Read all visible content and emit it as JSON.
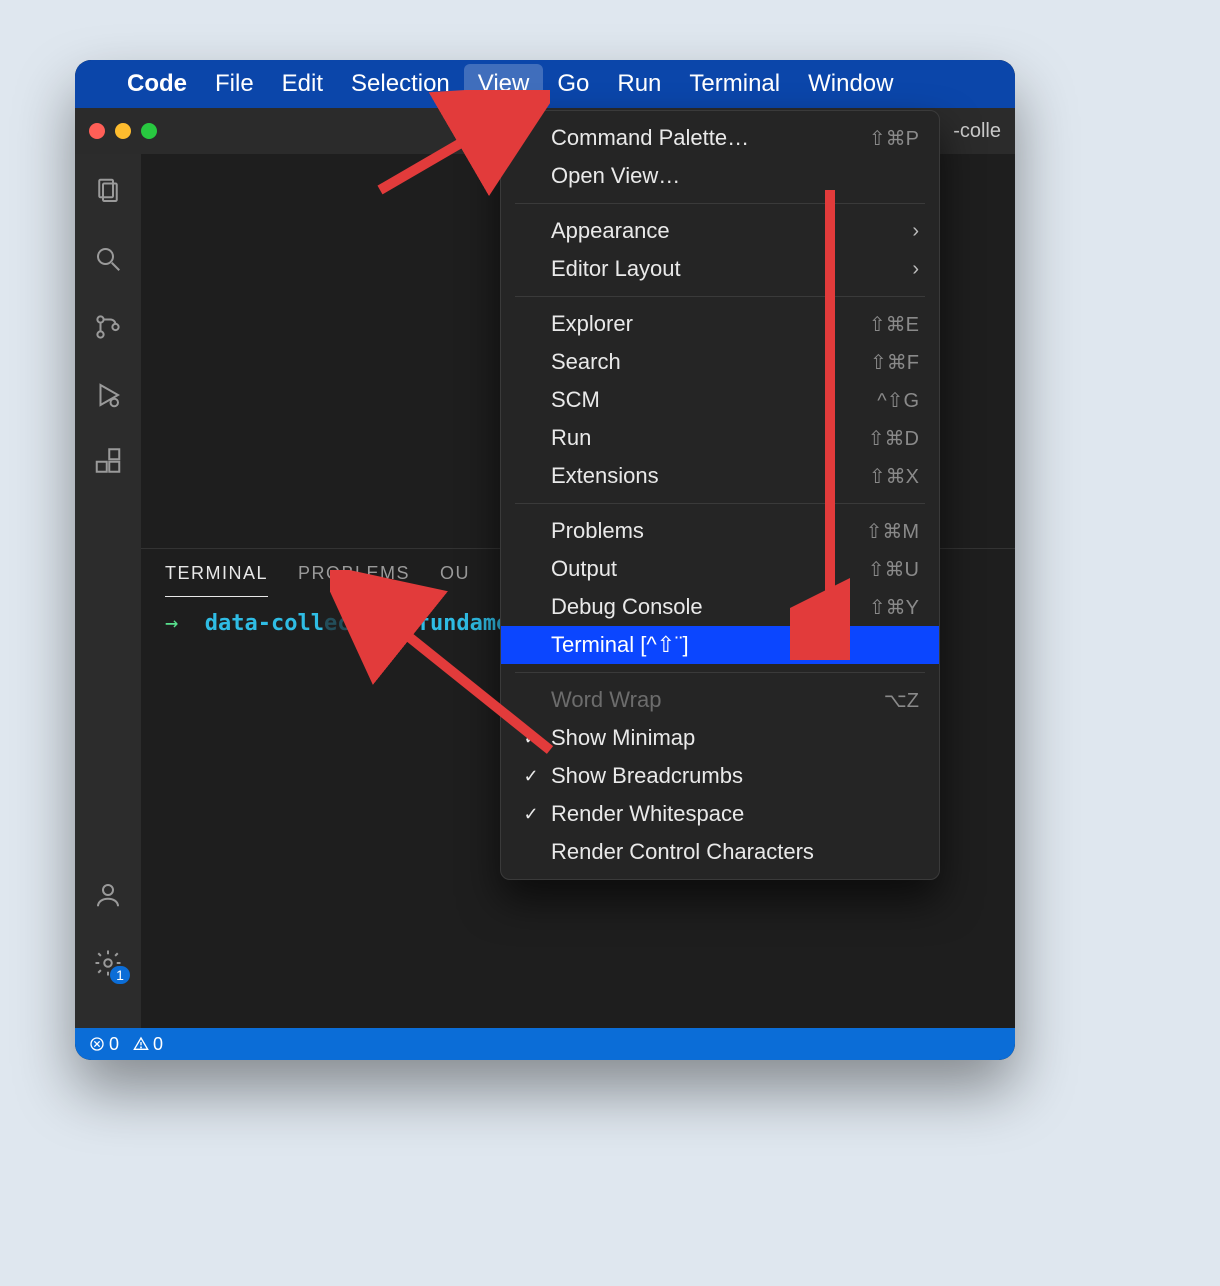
{
  "menubar": {
    "items": [
      "Code",
      "File",
      "Edit",
      "Selection",
      "View",
      "Go",
      "Run",
      "Terminal",
      "Window"
    ],
    "active_index": 4
  },
  "titlebar": {
    "project": "-colle"
  },
  "activitybar": {
    "settings_badge": "1"
  },
  "panel": {
    "tabs": [
      "TERMINAL",
      "PROBLEMS",
      "OU"
    ],
    "active_index": 0,
    "prompt_arrow": "→",
    "prompt_dir": "data-coll",
    "prompt_rest": "tion-fundame"
  },
  "statusbar": {
    "errors": "0",
    "warnings": "0"
  },
  "dropdown": {
    "groups": [
      [
        {
          "label": "Command Palette…",
          "shortcut": "⇧⌘P"
        },
        {
          "label": "Open View…",
          "shortcut": ""
        }
      ],
      [
        {
          "label": "Appearance",
          "submenu": true
        },
        {
          "label": "Editor Layout",
          "submenu": true
        }
      ],
      [
        {
          "label": "Explorer",
          "shortcut": "⇧⌘E"
        },
        {
          "label": "Search",
          "shortcut": "⇧⌘F"
        },
        {
          "label": "SCM",
          "shortcut": "^⇧G"
        },
        {
          "label": "Run",
          "shortcut": "⇧⌘D"
        },
        {
          "label": "Extensions",
          "shortcut": "⇧⌘X"
        }
      ],
      [
        {
          "label": "Problems",
          "shortcut": "⇧⌘M"
        },
        {
          "label": "Output",
          "shortcut": "⇧⌘U"
        },
        {
          "label": "Debug Console",
          "shortcut": "⇧⌘Y"
        },
        {
          "label": "Terminal [^⇧¨]",
          "shortcut": "",
          "highlight": true
        }
      ],
      [
        {
          "label": "Word Wrap",
          "shortcut": "⌥Z",
          "disabled": true
        },
        {
          "label": "Show Minimap",
          "checked": true
        },
        {
          "label": "Show Breadcrumbs",
          "checked": true
        },
        {
          "label": "Render Whitespace",
          "checked": true
        },
        {
          "label": "Render Control Characters"
        }
      ]
    ]
  }
}
